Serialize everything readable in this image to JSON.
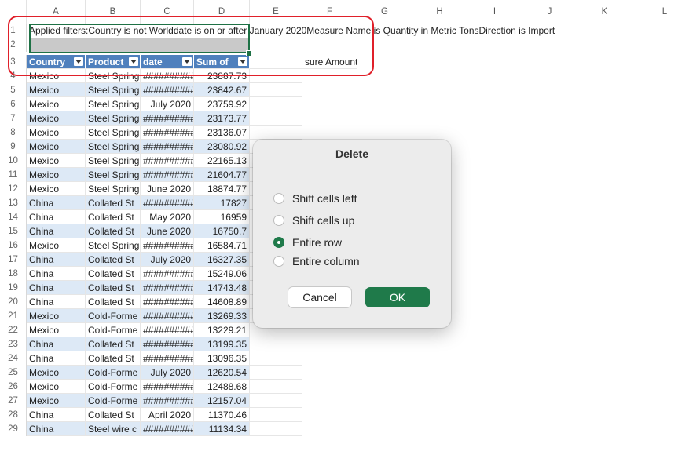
{
  "columns": [
    "",
    "A",
    "B",
    "C",
    "D",
    "E",
    "F",
    "G",
    "H",
    "I",
    "J",
    "K",
    "L"
  ],
  "row1_text": "Applied filters:Country is not Worlddate is on or after January 2020Measure Name is Quantity in Metric TonsDirection is Import",
  "headers": [
    "Country",
    "Product",
    "date",
    "Sum of "
  ],
  "header_f": "sure Amount",
  "rows": [
    {
      "n": "4",
      "country": "Mexico",
      "product": "Steel Spring",
      "date": "##########",
      "sum": "23887.73"
    },
    {
      "n": "5",
      "country": "Mexico",
      "product": "Steel Spring",
      "date": "##########",
      "sum": "23842.67"
    },
    {
      "n": "6",
      "country": "Mexico",
      "product": "Steel Spring",
      "date": "July 2020",
      "sum": "23759.92"
    },
    {
      "n": "7",
      "country": "Mexico",
      "product": "Steel Spring",
      "date": "##########",
      "sum": "23173.77"
    },
    {
      "n": "8",
      "country": "Mexico",
      "product": "Steel Spring",
      "date": "##########",
      "sum": "23136.07"
    },
    {
      "n": "9",
      "country": "Mexico",
      "product": "Steel Spring",
      "date": "##########",
      "sum": "23080.92"
    },
    {
      "n": "10",
      "country": "Mexico",
      "product": "Steel Spring",
      "date": "##########",
      "sum": "22165.13"
    },
    {
      "n": "11",
      "country": "Mexico",
      "product": "Steel Spring",
      "date": "##########",
      "sum": "21604.77"
    },
    {
      "n": "12",
      "country": "Mexico",
      "product": "Steel Spring",
      "date": "June 2020",
      "sum": "18874.77"
    },
    {
      "n": "13",
      "country": "China",
      "product": "Collated St",
      "date": "##########",
      "sum": "17827"
    },
    {
      "n": "14",
      "country": "China",
      "product": "Collated St",
      "date": "May 2020",
      "sum": "16959"
    },
    {
      "n": "15",
      "country": "China",
      "product": "Collated St",
      "date": "June 2020",
      "sum": "16750.7"
    },
    {
      "n": "16",
      "country": "Mexico",
      "product": "Steel Spring",
      "date": "##########",
      "sum": "16584.71"
    },
    {
      "n": "17",
      "country": "China",
      "product": "Collated St",
      "date": "July 2020",
      "sum": "16327.35"
    },
    {
      "n": "18",
      "country": "China",
      "product": "Collated St",
      "date": "##########",
      "sum": "15249.06"
    },
    {
      "n": "19",
      "country": "China",
      "product": "Collated St",
      "date": "##########",
      "sum": "14743.48"
    },
    {
      "n": "20",
      "country": "China",
      "product": "Collated St",
      "date": "##########",
      "sum": "14608.89"
    },
    {
      "n": "21",
      "country": "Mexico",
      "product": "Cold-Forme",
      "date": "##########",
      "sum": "13269.33"
    },
    {
      "n": "22",
      "country": "Mexico",
      "product": "Cold-Forme",
      "date": "##########",
      "sum": "13229.21"
    },
    {
      "n": "23",
      "country": "China",
      "product": "Collated St",
      "date": "##########",
      "sum": "13199.35"
    },
    {
      "n": "24",
      "country": "China",
      "product": "Collated St",
      "date": "##########",
      "sum": "13096.35"
    },
    {
      "n": "25",
      "country": "Mexico",
      "product": "Cold-Forme",
      "date": "July 2020",
      "sum": "12620.54"
    },
    {
      "n": "26",
      "country": "Mexico",
      "product": "Cold-Forme",
      "date": "##########",
      "sum": "12488.68"
    },
    {
      "n": "27",
      "country": "Mexico",
      "product": "Cold-Forme",
      "date": "##########",
      "sum": "12157.04"
    },
    {
      "n": "28",
      "country": "China",
      "product": "Collated St",
      "date": "April 2020",
      "sum": "11370.46"
    },
    {
      "n": "29",
      "country": "China",
      "product": "Steel wire c",
      "date": "##########",
      "sum": "11134.34"
    }
  ],
  "dialog": {
    "title": "Delete",
    "options": [
      "Shift cells left",
      "Shift cells up",
      "Entire row",
      "Entire column"
    ],
    "selected_index": 2,
    "cancel_label": "Cancel",
    "ok_label": "OK"
  },
  "colors": {
    "accent": "#1f7a4a",
    "header_fill": "#4f80bd",
    "band": "#dde9f6",
    "highlight": "#e0202a"
  }
}
